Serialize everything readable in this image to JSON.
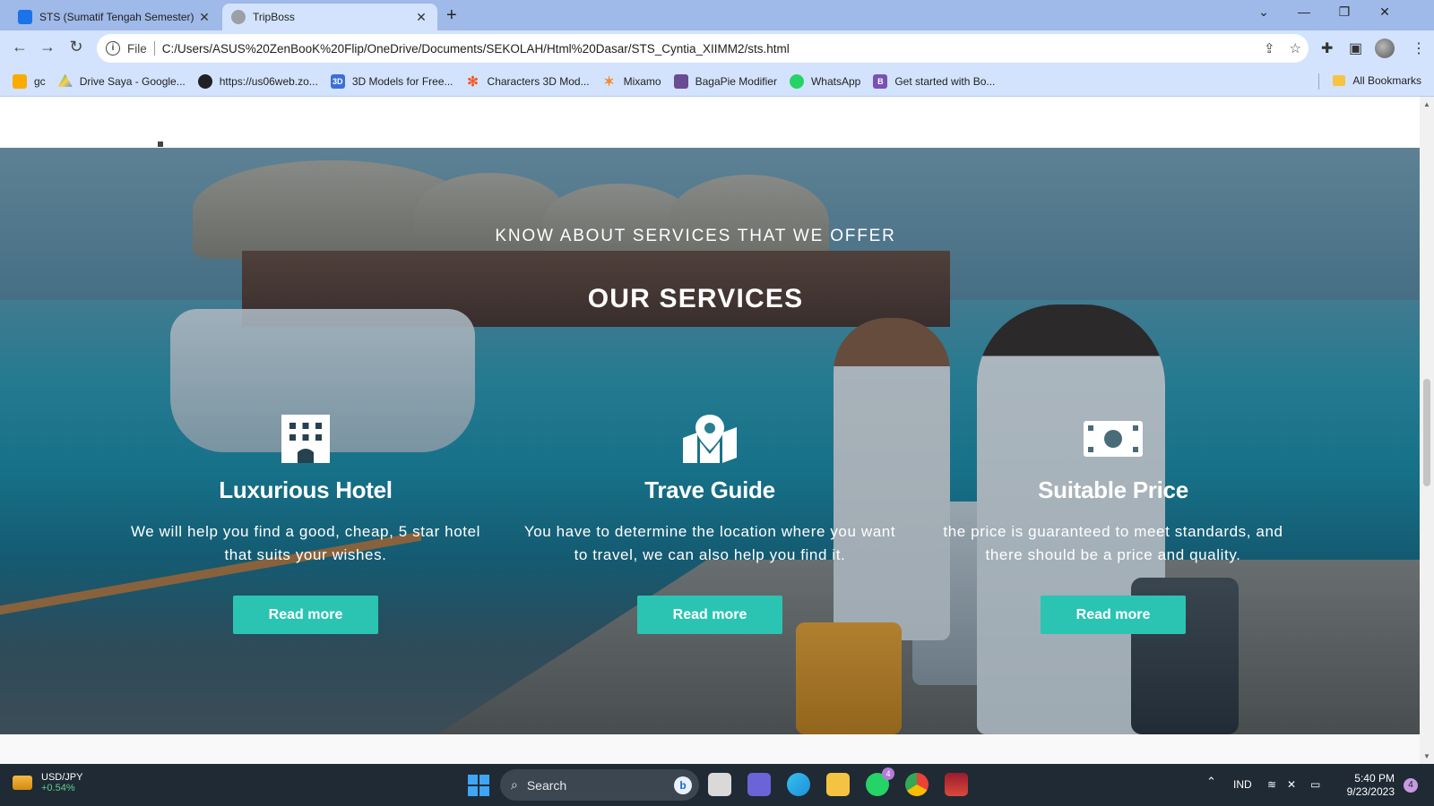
{
  "browser": {
    "tabs": [
      {
        "title": "STS (Sumatif Tengah Semester) C",
        "active": false,
        "favicon_color": "#1a73e8"
      },
      {
        "title": "TripBoss",
        "active": true,
        "favicon_color": "#9aa0a6"
      }
    ],
    "address": {
      "scheme_label": "File",
      "url": "C:/Users/ASUS%20ZenBooK%20Flip/OneDrive/Documents/SEKOLAH/Html%20Dasar/STS_Cyntia_XIIMM2/sts.html"
    },
    "bookmarks": [
      {
        "label": "gc",
        "icon": "classroom-icon",
        "color": "#f9ab00"
      },
      {
        "label": "Drive Saya - Google...",
        "icon": "drive-icon",
        "color": "#1fa463"
      },
      {
        "label": "https://us06web.zo...",
        "icon": "globe-icon",
        "color": "#202124"
      },
      {
        "label": "3D Models for Free...",
        "icon": "3d-icon",
        "color": "#3b6fd6"
      },
      {
        "label": "Characters 3D Mod...",
        "icon": "mixamo-star-icon",
        "color": "#f15a24"
      },
      {
        "label": "Mixamo",
        "icon": "mixamo-icon",
        "color": "#f28b2c"
      },
      {
        "label": "BagaPie Modifier",
        "icon": "bagapie-icon",
        "color": "#6a4c93"
      },
      {
        "label": "WhatsApp",
        "icon": "whatsapp-icon",
        "color": "#25d366"
      },
      {
        "label": "Get started with Bo...",
        "icon": "bootstrap-icon",
        "color": "#7952b3"
      }
    ],
    "all_bookmarks_label": "All Bookmarks"
  },
  "page": {
    "kicker": "KNOW ABOUT SERVICES THAT WE OFFER",
    "headline": "OUR SERVICES",
    "accent_color": "#2bc4b3",
    "services": [
      {
        "icon": "hotel-building-icon",
        "title": "Luxurious Hotel",
        "text": "We will help you find a good, cheap, 5 star hotel that suits your wishes.",
        "button": "Read more"
      },
      {
        "icon": "map-location-icon",
        "title": "Trave Guide",
        "text": "You have to determine the location where you want to travel, we can also help you find it.",
        "button": "Read more"
      },
      {
        "icon": "money-bill-icon",
        "title": "Suitable Price",
        "text": "the price is guaranteed to meet standards, and there should be a price and quality.",
        "button": "Read more"
      }
    ]
  },
  "taskbar": {
    "ticker_symbol": "USD/JPY",
    "ticker_change": "+0.54%",
    "search_label": "Search",
    "whatsapp_badge": "4",
    "language": "IND",
    "time": "5:40 PM",
    "date": "9/23/2023",
    "notification_count": "4"
  }
}
